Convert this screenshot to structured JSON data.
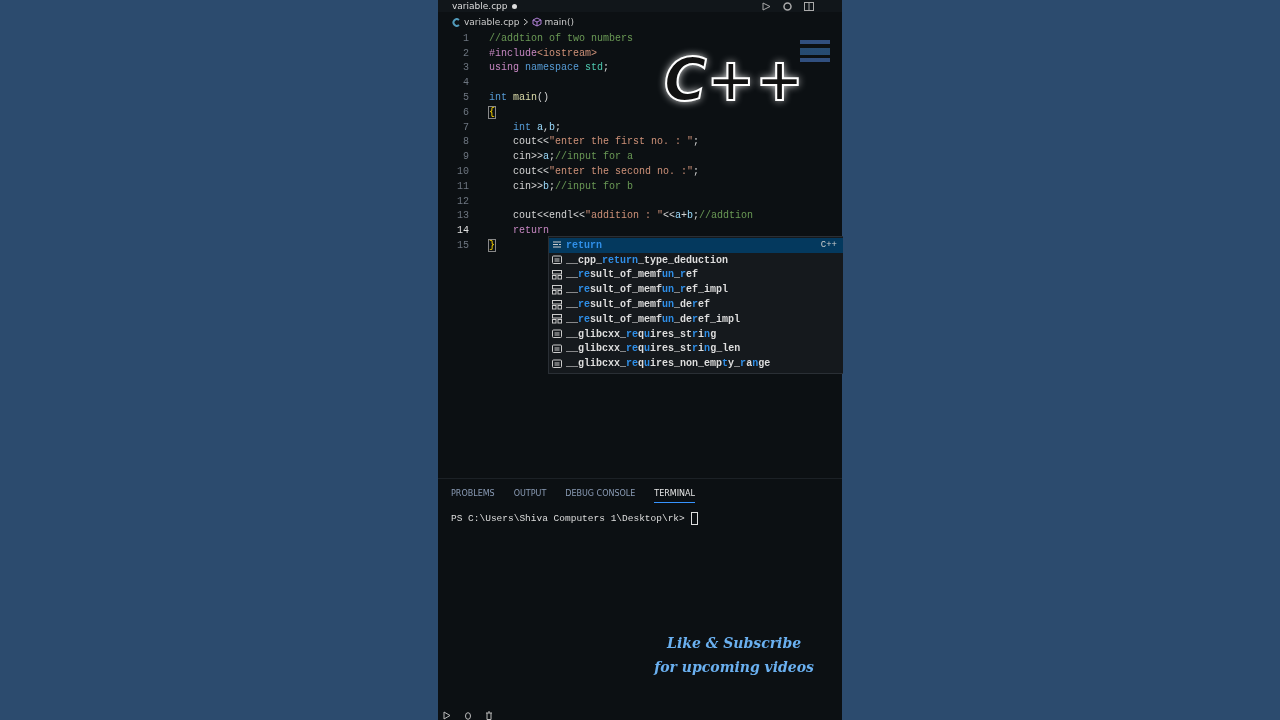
{
  "tab": {
    "title": "variable.cpp",
    "modified": true
  },
  "breadcrumb": {
    "file": "variable.cpp",
    "symbol": "main()"
  },
  "logo": {
    "text": "C++"
  },
  "lines": [
    {
      "number": "1",
      "selected": false,
      "indented": false,
      "tokens": [
        {
          "kind": "comment",
          "t": "//addtion of two numbers"
        }
      ]
    },
    {
      "number": "2",
      "selected": false,
      "indented": false,
      "tokens": [
        {
          "kind": "control",
          "t": "#include"
        },
        {
          "kind": "string",
          "t": "<iostream>"
        }
      ]
    },
    {
      "number": "3",
      "selected": false,
      "indented": false,
      "tokens": [
        {
          "kind": "control",
          "t": "using"
        },
        {
          "kind": "keyword",
          "t": " namespace"
        },
        {
          "kind": "type",
          "t": " std"
        },
        {
          "kind": "plain",
          "t": ";"
        }
      ]
    },
    {
      "number": "4",
      "selected": false
    },
    {
      "number": "5",
      "selected": false,
      "indented": false,
      "tokens": [
        {
          "kind": "keyword",
          "t": "int"
        },
        {
          "kind": "func",
          "t": " main"
        },
        {
          "kind": "plain",
          "t": "()"
        }
      ]
    },
    {
      "number": "6",
      "selected": false,
      "indented": false,
      "tokens": [
        {
          "kind": "bracket",
          "t": "{"
        }
      ]
    },
    {
      "number": "7",
      "selected": false,
      "indented": true,
      "tokens": [
        {
          "kind": "keyword",
          "t": "int"
        },
        {
          "kind": "var",
          "t": " a"
        },
        {
          "kind": "plain",
          "t": ","
        },
        {
          "kind": "var",
          "t": "b"
        },
        {
          "kind": "plain",
          "t": ";"
        }
      ]
    },
    {
      "number": "8",
      "selected": false,
      "indented": true,
      "tokens": [
        {
          "kind": "plain",
          "t": "cout<<"
        },
        {
          "kind": "string",
          "t": "\"enter the first no. : \""
        },
        {
          "kind": "plain",
          "t": ";"
        }
      ]
    },
    {
      "number": "9",
      "selected": false,
      "indented": true,
      "tokens": [
        {
          "kind": "plain",
          "t": "cin>>"
        },
        {
          "kind": "var",
          "t": "a"
        },
        {
          "kind": "plain",
          "t": ";"
        },
        {
          "kind": "comment",
          "t": "//input for a"
        }
      ]
    },
    {
      "number": "10",
      "selected": false,
      "indented": true,
      "tokens": [
        {
          "kind": "plain",
          "t": "cout<<"
        },
        {
          "kind": "string",
          "t": "\"enter the second no. :\""
        },
        {
          "kind": "plain",
          "t": ";"
        }
      ]
    },
    {
      "number": "11",
      "selected": false,
      "indented": true,
      "tokens": [
        {
          "kind": "plain",
          "t": "cin>>"
        },
        {
          "kind": "var",
          "t": "b"
        },
        {
          "kind": "plain",
          "t": ";"
        },
        {
          "kind": "comment",
          "t": "//input for b"
        }
      ]
    },
    {
      "number": "12",
      "selected": false
    },
    {
      "number": "13",
      "selected": false,
      "indented": true,
      "tokens": [
        {
          "kind": "plain",
          "t": "cout<<endl<<"
        },
        {
          "kind": "string",
          "t": "\"addition : \""
        },
        {
          "kind": "plain",
          "t": "<<"
        },
        {
          "kind": "var",
          "t": "a"
        },
        {
          "kind": "plain",
          "t": "+"
        },
        {
          "kind": "var",
          "t": "b"
        },
        {
          "kind": "plain",
          "t": ";"
        },
        {
          "kind": "comment",
          "t": "//addtion"
        }
      ]
    },
    {
      "number": "14",
      "selected": true,
      "indented": true,
      "tokens": [
        {
          "kind": "control",
          "t": "return"
        }
      ]
    },
    {
      "number": "15",
      "selected": false,
      "indented": false,
      "tokens": [
        {
          "kind": "bracket",
          "t": "}"
        }
      ]
    }
  ],
  "suggestions": [
    {
      "kind": "keyword",
      "selected": true,
      "detail": "C++",
      "segments": [
        {
          "t": "return",
          "match": true
        }
      ]
    },
    {
      "kind": "text",
      "selected": false,
      "segments": [
        {
          "t": "__cpp_",
          "match": false
        },
        {
          "t": "return",
          "match": true
        },
        {
          "t": "_type_deduction",
          "match": false
        }
      ]
    },
    {
      "kind": "struct",
      "selected": false,
      "segments": [
        {
          "t": "__",
          "match": false
        },
        {
          "t": "re",
          "match": true
        },
        {
          "t": "sult_of_memf",
          "match": false
        },
        {
          "t": "un",
          "match": true
        },
        {
          "t": "_",
          "match": false
        },
        {
          "t": "r",
          "match": true
        },
        {
          "t": "ef",
          "match": false
        }
      ]
    },
    {
      "kind": "struct",
      "selected": false,
      "segments": [
        {
          "t": "__",
          "match": false
        },
        {
          "t": "re",
          "match": true
        },
        {
          "t": "sult_of_memf",
          "match": false
        },
        {
          "t": "un",
          "match": true
        },
        {
          "t": "_",
          "match": false
        },
        {
          "t": "r",
          "match": true
        },
        {
          "t": "ef_impl",
          "match": false
        }
      ]
    },
    {
      "kind": "struct",
      "selected": false,
      "segments": [
        {
          "t": "__",
          "match": false
        },
        {
          "t": "re",
          "match": true
        },
        {
          "t": "sult_of_memf",
          "match": false
        },
        {
          "t": "un",
          "match": true
        },
        {
          "t": "_de",
          "match": false
        },
        {
          "t": "r",
          "match": true
        },
        {
          "t": "ef",
          "match": false
        }
      ]
    },
    {
      "kind": "struct",
      "selected": false,
      "segments": [
        {
          "t": "__",
          "match": false
        },
        {
          "t": "re",
          "match": true
        },
        {
          "t": "sult_of_memf",
          "match": false
        },
        {
          "t": "un",
          "match": true
        },
        {
          "t": "_de",
          "match": false
        },
        {
          "t": "r",
          "match": true
        },
        {
          "t": "ef_impl",
          "match": false
        }
      ]
    },
    {
      "kind": "text",
      "selected": false,
      "segments": [
        {
          "t": "__glibcxx_",
          "match": false
        },
        {
          "t": "re",
          "match": true
        },
        {
          "t": "q",
          "match": false
        },
        {
          "t": "u",
          "match": true
        },
        {
          "t": "ires_st",
          "match": false
        },
        {
          "t": "r",
          "match": true
        },
        {
          "t": "i",
          "match": false
        },
        {
          "t": "n",
          "match": true
        },
        {
          "t": "g",
          "match": false
        }
      ]
    },
    {
      "kind": "text",
      "selected": false,
      "segments": [
        {
          "t": "__glibcxx_",
          "match": false
        },
        {
          "t": "re",
          "match": true
        },
        {
          "t": "q",
          "match": false
        },
        {
          "t": "u",
          "match": true
        },
        {
          "t": "ires_st",
          "match": false
        },
        {
          "t": "r",
          "match": true
        },
        {
          "t": "i",
          "match": false
        },
        {
          "t": "n",
          "match": true
        },
        {
          "t": "g_len",
          "match": false
        }
      ]
    },
    {
      "kind": "text",
      "selected": false,
      "segments": [
        {
          "t": "__glibcxx_",
          "match": false
        },
        {
          "t": "re",
          "match": true
        },
        {
          "t": "q",
          "match": false
        },
        {
          "t": "u",
          "match": true
        },
        {
          "t": "ires_non_emp",
          "match": false
        },
        {
          "t": "t",
          "match": true
        },
        {
          "t": "y_",
          "match": false
        },
        {
          "t": "r",
          "match": true
        },
        {
          "t": "a",
          "match": false
        },
        {
          "t": "n",
          "match": true
        },
        {
          "t": "ge",
          "match": false
        }
      ]
    }
  ],
  "panel_tabs": [
    {
      "label": "PROBLEMS",
      "selected": false
    },
    {
      "label": "OUTPUT",
      "selected": false
    },
    {
      "label": "DEBUG CONSOLE",
      "selected": false
    },
    {
      "label": "TERMINAL",
      "selected": true
    }
  ],
  "terminal": {
    "prompt": "PS C:\\Users\\Shiva Computers 1\\Desktop\\rk>"
  },
  "overlay": {
    "line_1": "Like & Subscribe",
    "line_2": "for upcoming videos"
  }
}
